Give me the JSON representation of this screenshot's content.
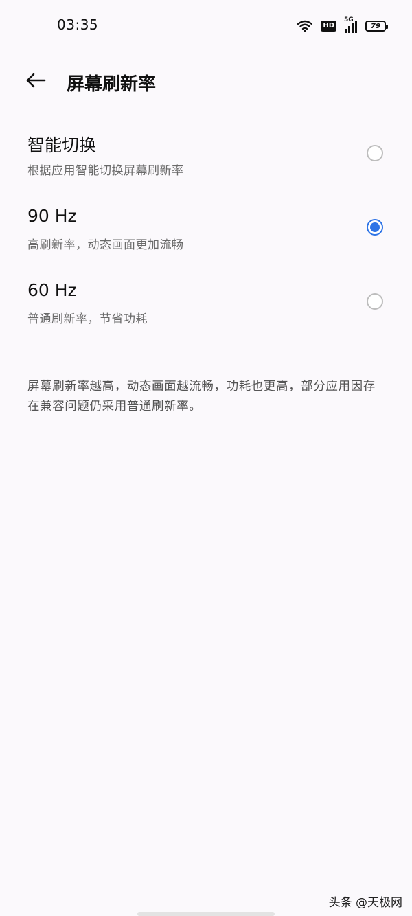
{
  "status_bar": {
    "time": "03:35",
    "icons": [
      "wifi-icon",
      "hd-icon",
      "signal-icon",
      "battery-icon"
    ],
    "hd_label": "HD",
    "signal_label": "5G",
    "battery_level": "79"
  },
  "header": {
    "back_icon": "arrow-left-icon",
    "title": "屏幕刷新率"
  },
  "options": [
    {
      "title": "智能切换",
      "subtitle": "根据应用智能切换屏幕刷新率",
      "selected": false
    },
    {
      "title": "90 Hz",
      "subtitle": "高刷新率，动态画面更加流畅",
      "selected": true
    },
    {
      "title": "60 Hz",
      "subtitle": "普通刷新率，节省功耗",
      "selected": false
    }
  ],
  "note": "屏幕刷新率越高，动态画面越流畅，功耗也更高，部分应用因存在兼容问题仍采用普通刷新率。",
  "watermark": "头条 @天极网",
  "colors": {
    "accent": "#2e74e6",
    "background": "#fbf9fc"
  }
}
